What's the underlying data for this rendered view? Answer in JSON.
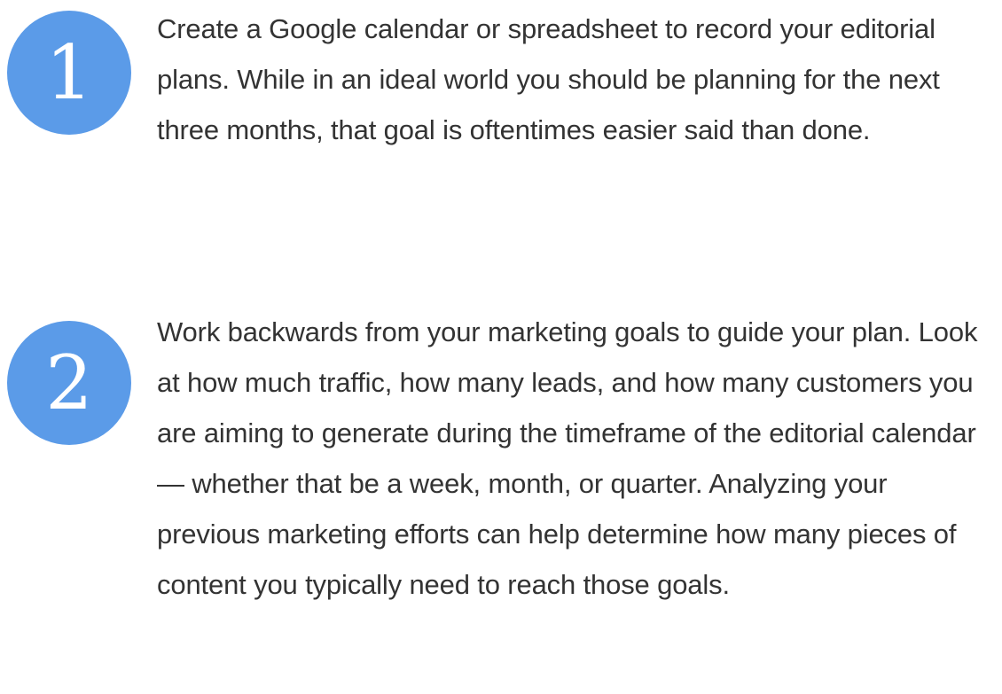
{
  "steps": [
    {
      "number": "1",
      "text": "Create a Google calendar or spreadsheet to record your editorial plans. While in an ideal world you should be planning for the next three months, that goal is oftentimes easier said than done."
    },
    {
      "number": "2",
      "text": "Work backwards from your marketing goals to guide your plan. Look at how much traffic, how many leads, and how many customers you are aiming to generate during the timeframe of the editorial calendar — whether that be a week, month, or quarter. Analyzing your previous marketing efforts can help determine how many pieces of content you typically need to reach those goals."
    }
  ],
  "colors": {
    "badge": "#5b9be8",
    "text": "#333333"
  }
}
